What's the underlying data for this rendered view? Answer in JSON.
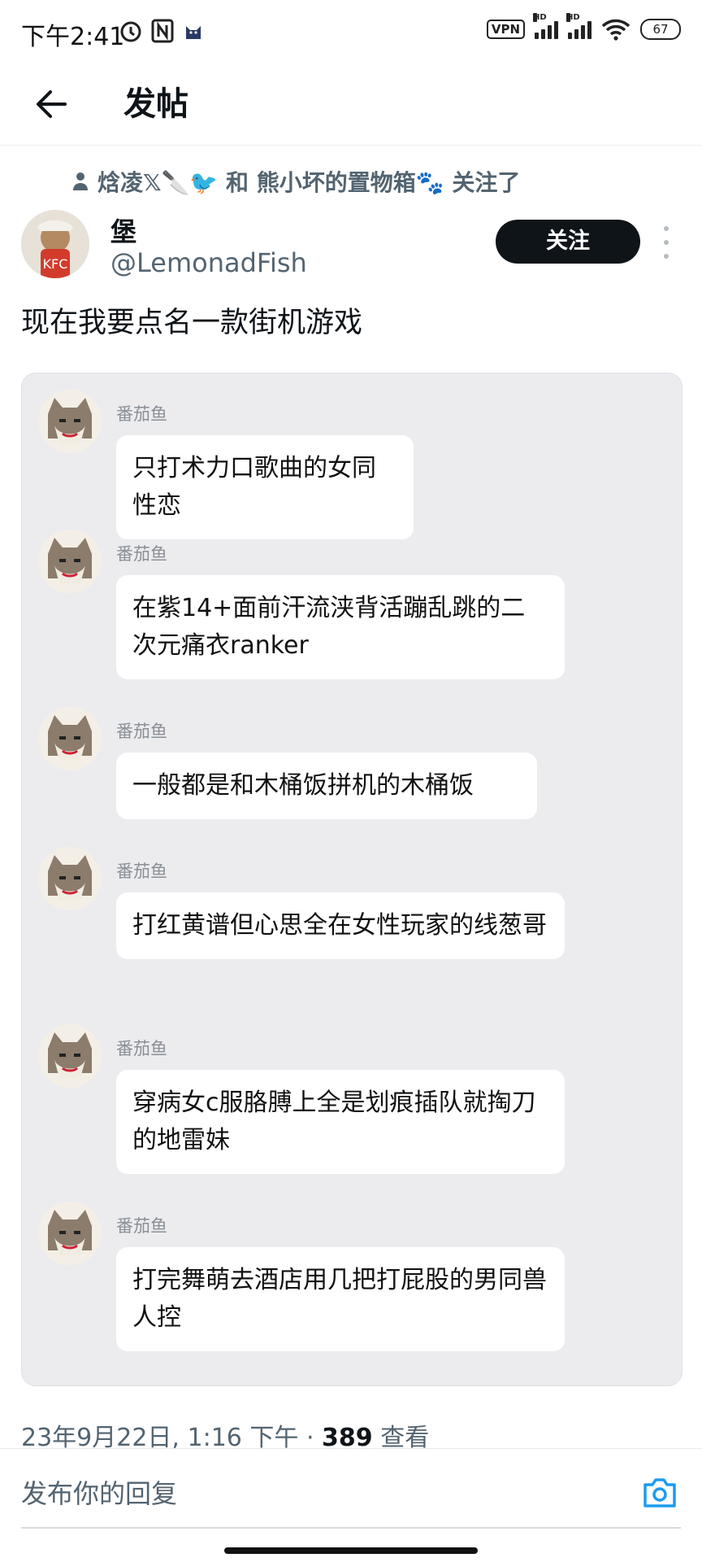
{
  "status_bar": {
    "time": "下午2:41",
    "vpn": "VPN",
    "hd1": "HD",
    "hd2": "HD",
    "battery": "67"
  },
  "header": {
    "title": "发帖"
  },
  "context": {
    "text": "焓凌𝕏🔪🐦 和 熊小坏的置物箱🐾 关注了"
  },
  "author": {
    "name": "堡",
    "handle": "@LemonadFish",
    "follow_label": "关注"
  },
  "tweet": {
    "text": "现在我要点名一款街机游戏"
  },
  "chat": {
    "messages": [
      {
        "sender": "番茄鱼",
        "text": "只打术力口歌曲的女同性恋"
      },
      {
        "sender": "番茄鱼",
        "text": "在紫14+面前汗流浃背活蹦乱跳的二次元痛衣ranker"
      },
      {
        "sender": "番茄鱼",
        "text": "一般都是和木桶饭拼机的木桶饭"
      },
      {
        "sender": "番茄鱼",
        "text": "打红黄谱但心思全在女性玩家的线葱哥"
      },
      {
        "sender": "番茄鱼",
        "text": "穿病女c服胳膊上全是划痕插队就掏刀的地雷妹"
      },
      {
        "sender": "番茄鱼",
        "text": "打完舞萌去酒店用几把打屁股的男同兽人控"
      }
    ]
  },
  "meta": {
    "date": "23年9月22日, 1:16 下午 · ",
    "views": "389",
    "views_label": " 查看"
  },
  "reply": {
    "placeholder": "发布你的回复"
  },
  "icons": {
    "back": "arrow-left-icon",
    "camera": "camera-icon",
    "more": "more-vertical-icon"
  }
}
